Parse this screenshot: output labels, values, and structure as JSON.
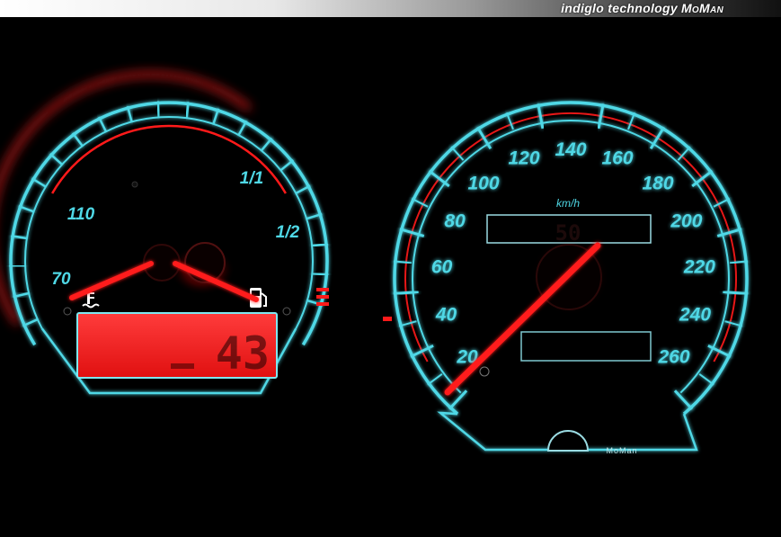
{
  "header": {
    "brand_text": "indiglo technology",
    "maker": "MoMan"
  },
  "tach_gauge": {
    "labels": [
      "70",
      "110",
      "1/1",
      "1/2"
    ],
    "lcd_value": "43",
    "coolant_icon": "coolant-temperature-icon",
    "fuel_icon": "fuel-pump-icon"
  },
  "speedometer": {
    "unit": "km/h",
    "labels": [
      "20",
      "40",
      "60",
      "80",
      "100",
      "120",
      "140",
      "160",
      "180",
      "200",
      "220",
      "240",
      "260"
    ],
    "display_value": "50",
    "maker_mark": "MoMan"
  },
  "colors": {
    "glow_cyan": "#4fd8e6",
    "needle_red": "#ff1a1a",
    "lcd_red": "#ff2a2a"
  }
}
